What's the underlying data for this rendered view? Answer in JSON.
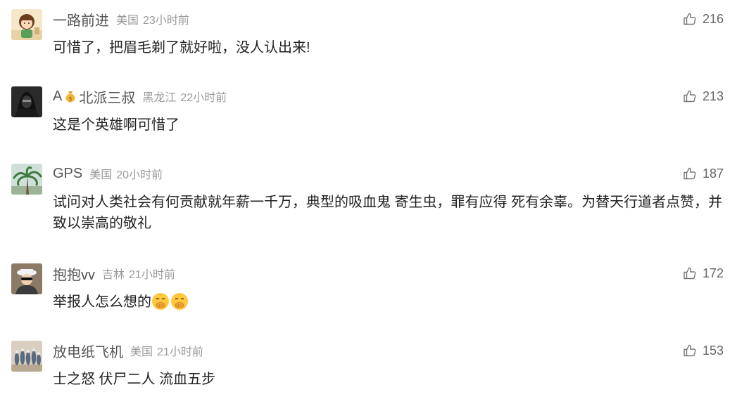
{
  "comments": [
    {
      "username": "一路前进",
      "location": "美国",
      "time": "23小时前",
      "content": "可惜了，把眉毛剃了就好啦，没人认出来!",
      "likes": "216",
      "avatar": "avatar-girl-cartoon"
    },
    {
      "username": "A",
      "badge": "money-bag-icon",
      "username_suffix": "北派三叔",
      "location": "黑龙江",
      "time": "22小时前",
      "content": "这是个英雄啊可惜了",
      "likes": "213",
      "avatar": "avatar-hooded-figure"
    },
    {
      "username": "GPS",
      "location": "美国",
      "time": "20小时前",
      "content": "试问对人类社会有何贡献就年薪一千万，典型的吸血鬼 寄生虫，罪有应得 死有余辜。为替天行道者点赞，并致以崇高的敬礼",
      "likes": "187",
      "avatar": "avatar-palm-tree"
    },
    {
      "username": "抱抱vv",
      "location": "吉林",
      "time": "21小时前",
      "content": "举报人怎么想的",
      "content_emojis": [
        "hand-over-mouth-emoji",
        "hand-over-mouth-emoji"
      ],
      "likes": "172",
      "avatar": "avatar-person-hat"
    },
    {
      "username": "放电纸飞机",
      "location": "美国",
      "time": "21小时前",
      "content": "士之怒 伏尸二人 流血五步",
      "likes": "153",
      "avatar": "avatar-bowling-pins"
    }
  ],
  "colors": {
    "username": "#555555",
    "meta": "#9a9a9a",
    "content": "#222222",
    "like": "#666666"
  }
}
